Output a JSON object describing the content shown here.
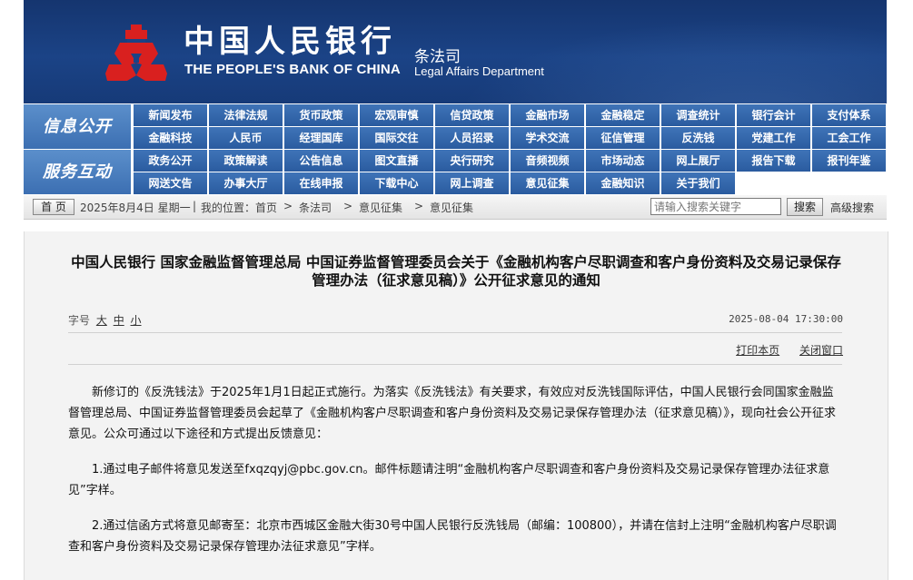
{
  "header": {
    "cn_name": "中国人民银行",
    "en_name": "THE PEOPLE'S BANK OF CHINA",
    "dept_cn": "条法司",
    "dept_en": "Legal Affairs Department",
    "logo_icon": "pboc-emblem-icon",
    "colors": {
      "banner": "#1b4386",
      "logo": "#d9201f",
      "nav": "#2f63a8"
    }
  },
  "nav": {
    "row1_label": "信息公开",
    "row2_label": "服务互动",
    "row1_top": [
      "新闻发布",
      "法律法规",
      "货币政策",
      "宏观审慎",
      "信贷政策",
      "金融市场",
      "金融稳定",
      "调查统计",
      "银行会计",
      "支付体系"
    ],
    "row1_bottom": [
      "金融科技",
      "人民币",
      "经理国库",
      "国际交往",
      "人员招录",
      "学术交流",
      "征信管理",
      "反洗钱",
      "党建工作",
      "工会工作"
    ],
    "row2_top": [
      "政务公开",
      "政策解读",
      "公告信息",
      "图文直播",
      "央行研究",
      "音频视频",
      "市场动态",
      "网上展厅",
      "报告下载",
      "报刊年鉴"
    ],
    "row2_bottom": [
      "网送文告",
      "办事大厅",
      "在线申报",
      "下载中心",
      "网上调查",
      "意见征集",
      "金融知识",
      "关于我们"
    ]
  },
  "crumb": {
    "home": "首 页",
    "date": "2025年8月4日 星期一",
    "location": "我的位置：首页",
    "sep": ">",
    "items": [
      "条法司",
      "意见征集",
      "意见征集"
    ],
    "search_placeholder": "请输入搜索关键字",
    "search_button": "搜索",
    "advanced": "高级搜索"
  },
  "article": {
    "title_line1": "中国人民银行  国家金融监督管理总局  中国证券监督管理委员会关于《金融机构客户尽职调查和客户身份资料及交易记录保存",
    "title_line2": "管理办法（征求意见稿）》公开征求意见的通知",
    "font_label": "字号",
    "font_large": "大",
    "font_medium": "中",
    "font_small": "小",
    "datetime": "2025-08-04 17:30:00",
    "print": "打印本页",
    "close": "关闭窗口",
    "paragraphs": [
      "新修订的《反洗钱法》于2025年1月1日起正式施行。为落实《反洗钱法》有关要求，有效应对反洗钱国际评估，中国人民银行会同国家金融监督管理总局、中国证券监督管理委员会起草了《金融机构客户尽职调查和客户身份资料及交易记录保存管理办法（征求意见稿）》，现向社会公开征求意见。公众可通过以下途径和方式提出反馈意见：",
      "1.通过电子邮件将意见发送至fxqzqyj@pbc.gov.cn。邮件标题请注明“金融机构客户尽职调查和客户身份资料及交易记录保存管理办法征求意见”字样。",
      "2.通过信函方式将意见邮寄至：北京市西城区金融大街30号中国人民银行反洗钱局（邮编：100800），并请在信封上注明“金融机构客户尽职调查和客户身份资料及交易记录保存管理办法征求意见”字样。"
    ]
  }
}
